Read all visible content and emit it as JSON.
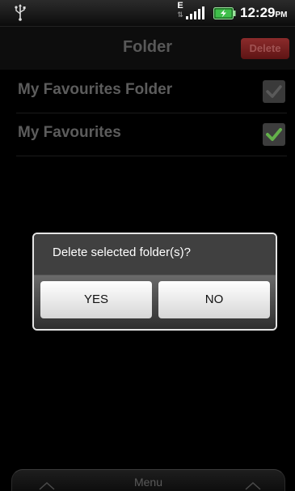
{
  "status_bar": {
    "time": "12:29",
    "ampm": "PM",
    "network_type": "E",
    "network_arrows": "⇅",
    "icons": [
      "usb-icon",
      "data-activity-icon",
      "signal-strength-icon",
      "battery-charging-icon"
    ]
  },
  "header": {
    "title": "Folder",
    "delete_label": "Delete"
  },
  "folders": [
    {
      "name": "My Favourites Folder",
      "checked": true,
      "enabled": false
    },
    {
      "name": "My Favourites",
      "checked": true,
      "enabled": true
    }
  ],
  "dialog": {
    "message": "Delete selected folder(s)?",
    "yes_label": "YES",
    "no_label": "NO"
  },
  "menu": {
    "label": "Menu"
  },
  "colors": {
    "check_green": "#63b04a",
    "check_disabled": "#5a5a5a",
    "delete_red": "#7a2020"
  }
}
